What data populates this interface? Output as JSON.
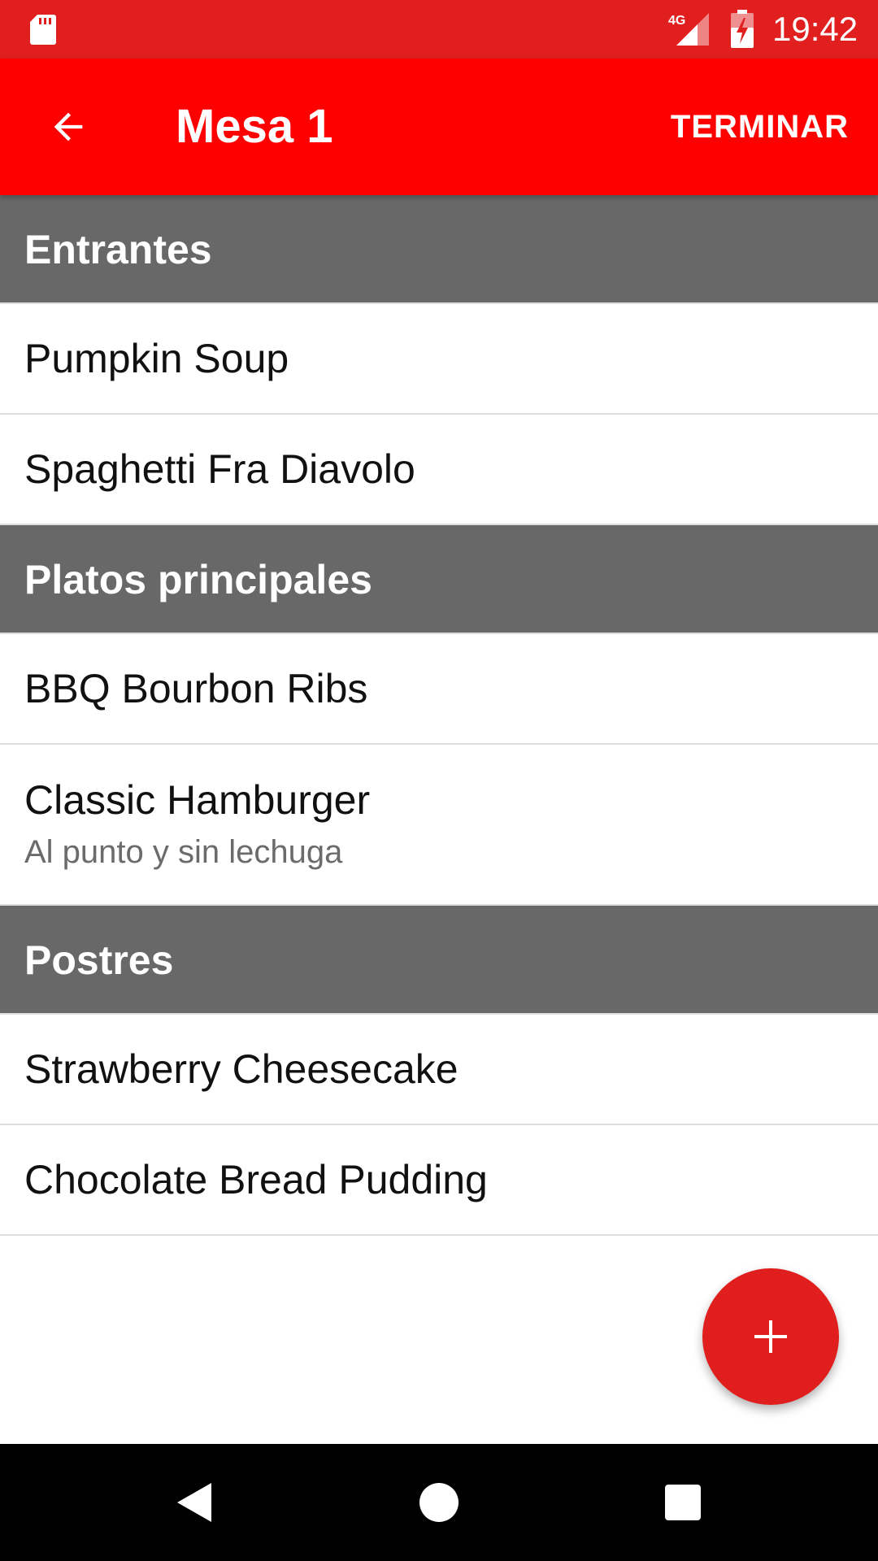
{
  "status_bar": {
    "time": "19:42",
    "network": "4G",
    "icons": [
      "sd-card-icon",
      "signal-icon",
      "battery-charging-icon"
    ]
  },
  "app_bar": {
    "back_icon": "arrow-back-icon",
    "title": "Mesa 1",
    "action_label": "TERMINAR"
  },
  "sections": [
    {
      "title": "Entrantes",
      "items": [
        {
          "name": "Pumpkin Soup"
        },
        {
          "name": "Spaghetti Fra Diavolo"
        }
      ]
    },
    {
      "title": "Platos principales",
      "items": [
        {
          "name": "BBQ Bourbon Ribs"
        },
        {
          "name": "Classic Hamburger",
          "note": "Al punto y sin lechuga"
        }
      ]
    },
    {
      "title": "Postres",
      "items": [
        {
          "name": "Strawberry Cheesecake"
        },
        {
          "name": "Chocolate Bread Pudding"
        }
      ]
    }
  ],
  "fab": {
    "icon": "plus-icon"
  },
  "nav_bar": {
    "icons": [
      "nav-back-icon",
      "nav-home-icon",
      "nav-recents-icon"
    ]
  },
  "colors": {
    "status_bar": "#e11f1f",
    "app_bar": "#ff0000",
    "section_header": "#686868",
    "fab": "#e01e1e",
    "nav_bar": "#000000"
  }
}
